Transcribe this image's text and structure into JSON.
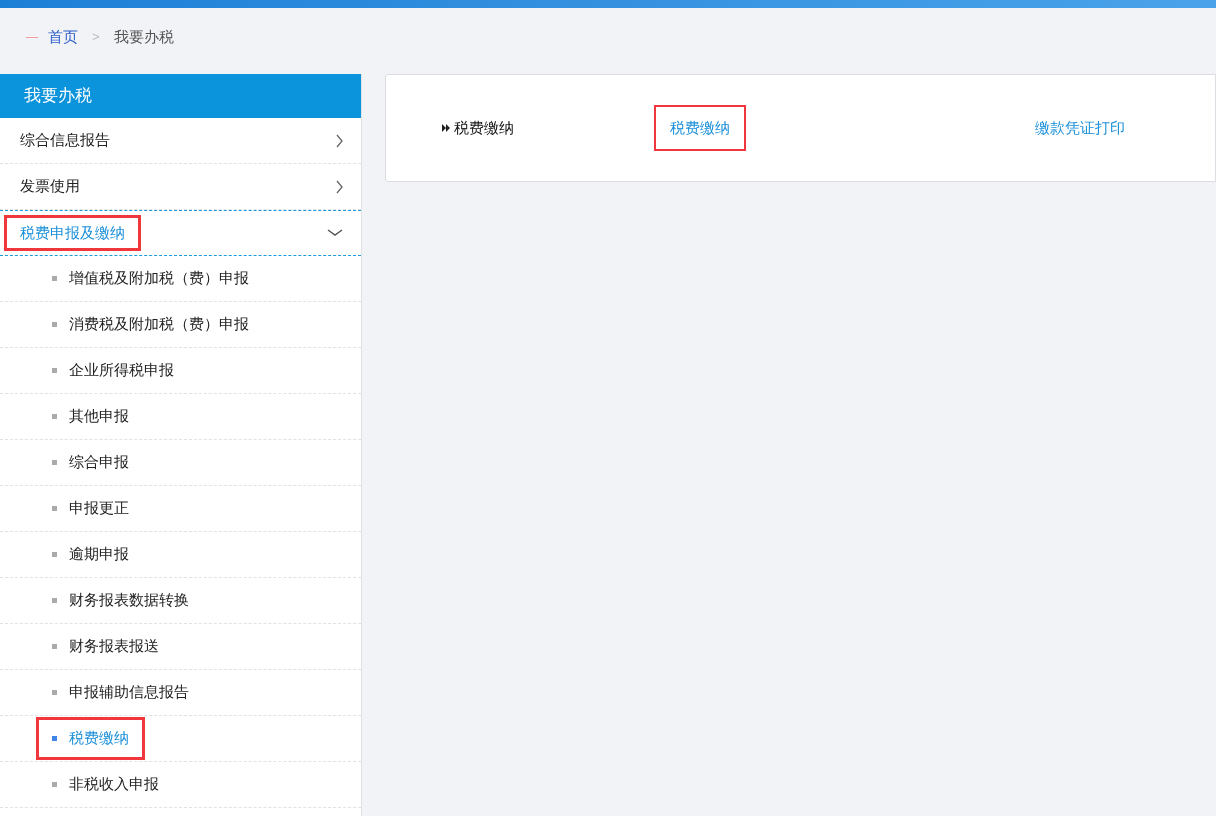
{
  "breadcrumb": {
    "items": [
      {
        "label": "首页",
        "link": true
      },
      {
        "label": "我要办税",
        "link": false
      }
    ],
    "separator": ">"
  },
  "sidebar": {
    "title": "我要办税",
    "items": [
      {
        "label": "综合信息报告",
        "expanded": false,
        "highlighted": false
      },
      {
        "label": "发票使用",
        "expanded": false,
        "highlighted": false
      },
      {
        "label": "税费申报及缴纳",
        "expanded": true,
        "highlighted": true,
        "children": [
          {
            "label": "增值税及附加税（费）申报",
            "selected": false,
            "highlighted": false
          },
          {
            "label": "消费税及附加税（费）申报",
            "selected": false,
            "highlighted": false
          },
          {
            "label": "企业所得税申报",
            "selected": false,
            "highlighted": false
          },
          {
            "label": "其他申报",
            "selected": false,
            "highlighted": false
          },
          {
            "label": "综合申报",
            "selected": false,
            "highlighted": false
          },
          {
            "label": "申报更正",
            "selected": false,
            "highlighted": false
          },
          {
            "label": "逾期申报",
            "selected": false,
            "highlighted": false
          },
          {
            "label": "财务报表数据转换",
            "selected": false,
            "highlighted": false
          },
          {
            "label": "财务报表报送",
            "selected": false,
            "highlighted": false
          },
          {
            "label": "申报辅助信息报告",
            "selected": false,
            "highlighted": false
          },
          {
            "label": "税费缴纳",
            "selected": true,
            "highlighted": true
          },
          {
            "label": "非税收入申报",
            "selected": false,
            "highlighted": false
          }
        ]
      }
    ]
  },
  "content": {
    "section_label": "税费缴纳",
    "links": [
      {
        "label": "税费缴纳",
        "highlighted": true
      },
      {
        "label": "缴款凭证打印",
        "highlighted": false
      }
    ]
  }
}
